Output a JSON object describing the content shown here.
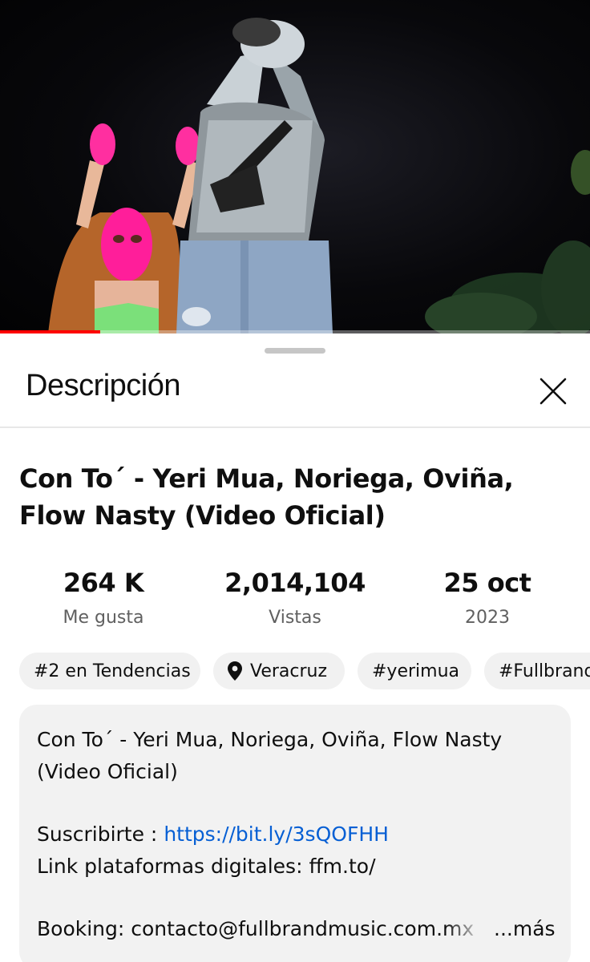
{
  "video": {
    "progress_fraction": 0.17
  },
  "sheet": {
    "title": "Descripción",
    "close_icon": "close-icon"
  },
  "video_info": {
    "title": "Con To´ - Yeri Mua, Noriega, Oviña, Flow Nasty  (Video Oficial)",
    "stats": [
      {
        "value": "264 K",
        "label": "Me gusta"
      },
      {
        "value": "2,014,104",
        "label": "Vistas"
      },
      {
        "value": "25 oct",
        "label": "2023"
      }
    ],
    "chips": [
      {
        "label": "#2 en Tendencias"
      },
      {
        "label": "Veracruz",
        "icon": "location-pin-icon"
      },
      {
        "label": "#yerimua"
      },
      {
        "label": "#Fullbrand"
      }
    ]
  },
  "description": {
    "line1": "Con To´ - Yeri Mua, Noriega, Oviña, Flow Nasty",
    "line2": "(Video Oficial)",
    "subscribe_label": "Suscribirte : ",
    "subscribe_link": "https://bit.ly/3sQOFHH",
    "platforms": "Link plataformas digitales: ffm.to/",
    "booking": "Booking: contacto@fullbrandmusic.com.mx",
    "more_label": "...más"
  },
  "colors": {
    "progress": "#ff0000",
    "link": "#065fd4",
    "secondary_text": "#606060",
    "chip_bg": "#f1f1f1"
  }
}
